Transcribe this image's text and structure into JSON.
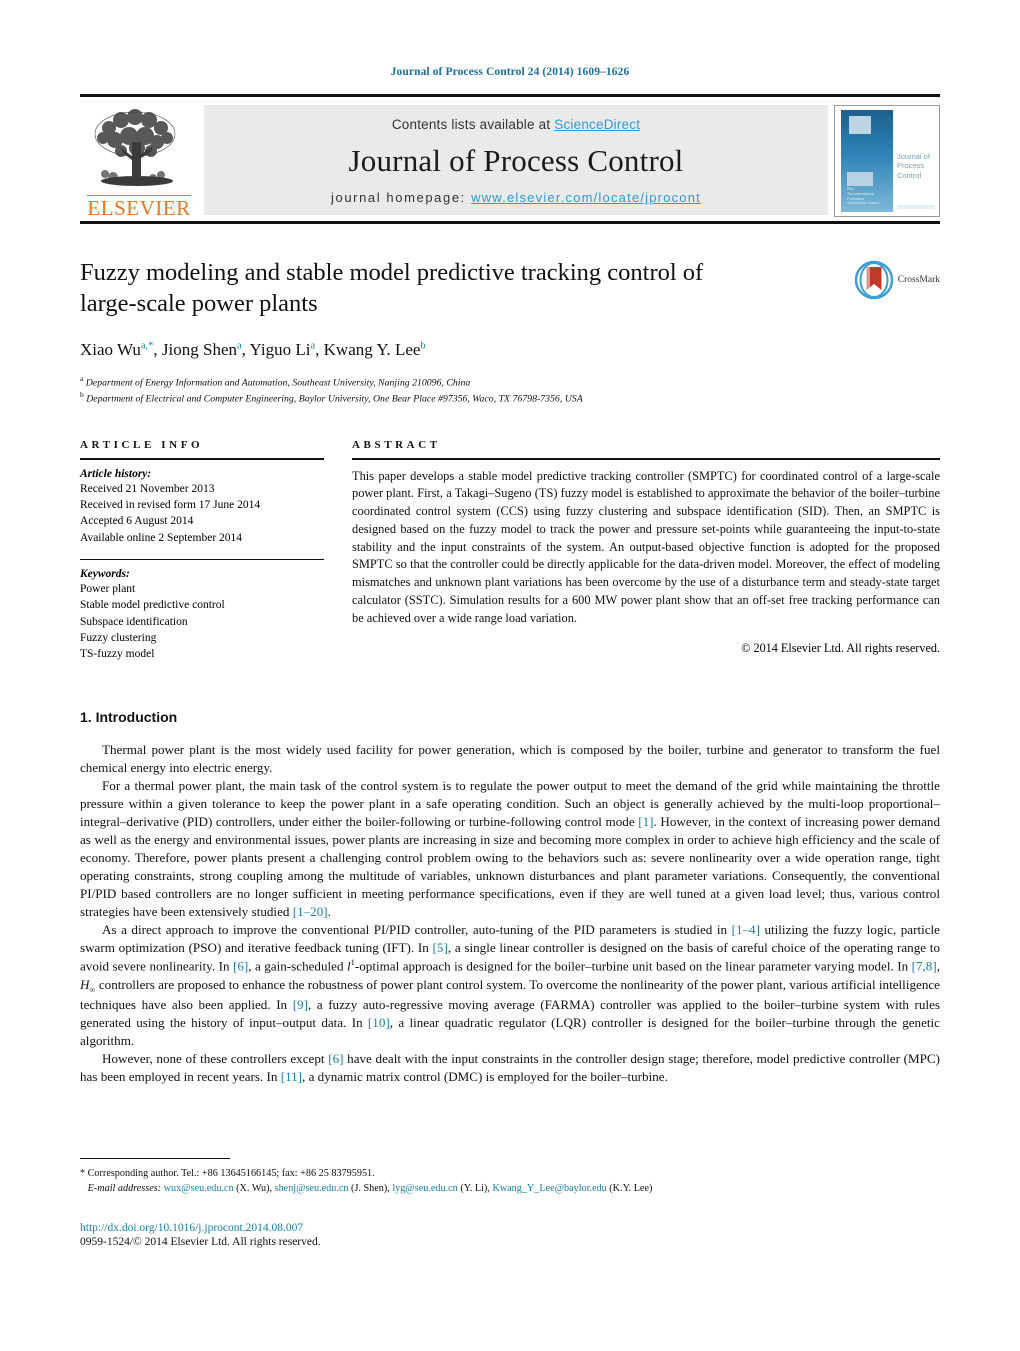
{
  "running_head": "Journal of Process Control 24 (2014) 1609–1626",
  "header": {
    "contents_prefix": "Contents lists available at ",
    "sciencedirect": "ScienceDirect",
    "journal_name": "Journal of Process Control",
    "homepage_prefix": "journal homepage: ",
    "homepage_url": "www.elsevier.com/locate/jprocont",
    "publisher_wordmark": "ELSEVIER",
    "cover_title": "Journal of\nProcess Control",
    "link_color": "#2e9bd6",
    "brand_orange": "#e87722"
  },
  "title": "Fuzzy modeling and stable model predictive tracking control of large-scale power plants",
  "authors_plain": "Xiao Wu a,*, Jiong Shen a, Yiguo Li a, Kwang Y. Lee b",
  "affiliations": [
    "Department of Energy Information and Automation, Southeast University, Nanjing 210096, China",
    "Department of Electrical and Computer Engineering, Baylor University, One Bear Place #97356, Waco, TX 76798-7356, USA"
  ],
  "crossmark_label": "CrossMark",
  "article_info": {
    "heading": "ARTICLE INFO",
    "history_label": "Article history:",
    "history": [
      "Received 21 November 2013",
      "Received in revised form 17 June 2014",
      "Accepted 6 August 2014",
      "Available online 2 September 2014"
    ],
    "keywords_label": "Keywords:",
    "keywords": [
      "Power plant",
      "Stable model predictive control",
      "Subspace identification",
      "Fuzzy clustering",
      "TS-fuzzy model"
    ]
  },
  "abstract": {
    "heading": "ABSTRACT",
    "text": "This paper develops a stable model predictive tracking controller (SMPTC) for coordinated control of a large-scale power plant. First, a Takagi–Sugeno (TS) fuzzy model is established to approximate the behavior of the boiler–turbine coordinated control system (CCS) using fuzzy clustering and subspace identification (SID). Then, an SMPTC is designed based on the fuzzy model to track the power and pressure set-points while guaranteeing the input-to-state stability and the input constraints of the system. An output-based objective function is adopted for the proposed SMPTC so that the controller could be directly applicable for the data-driven model. Moreover, the effect of modeling mismatches and unknown plant variations has been overcome by the use of a disturbance term and steady-state target calculator (SSTC). Simulation results for a 600 MW power plant show that an off-set free tracking performance can be achieved over a wide range load variation.",
    "copyright": "© 2014 Elsevier Ltd. All rights reserved."
  },
  "section": {
    "number_title": "1. Introduction",
    "paragraphs": [
      "Thermal power plant is the most widely used facility for power generation, which is composed by the boiler, turbine and generator to transform the fuel chemical energy into electric energy.",
      "For a thermal power plant, the main task of the control system is to regulate the power output to meet the demand of the grid while maintaining the throttle pressure within a given tolerance to keep the power plant in a safe operating condition. Such an object is generally achieved by the multi-loop proportional–integral–derivative (PID) controllers, under either the boiler-following or turbine-following control mode [1]. However, in the context of increasing power demand as well as the energy and environmental issues, power plants are increasing in size and becoming more complex in order to achieve high efficiency and the scale of economy. Therefore, power plants present a challenging control problem owing to the behaviors such as: severe nonlinearity over a wide operation range, tight operating constraints, strong coupling among the multitude of variables, unknown disturbances and plant parameter variations. Consequently, the conventional PI/PID based controllers are no longer sufficient in meeting performance specifications, even if they are well tuned at a given load level; thus, various control strategies have been extensively studied [1–20].",
      "As a direct approach to improve the conventional PI/PID controller, auto-tuning of the PID parameters is studied in [1–4] utilizing the fuzzy logic, particle swarm optimization (PSO) and iterative feedback tuning (IFT). In [5], a single linear controller is designed on the basis of careful choice of the operating range to avoid severe nonlinearity. In [6], a gain-scheduled l1-optimal approach is designed for the boiler–turbine unit based on the linear parameter varying model. In [7,8], H∞ controllers are proposed to enhance the robustness of power plant control system. To overcome the nonlinearity of the power plant, various artificial intelligence techniques have also been applied. In [9], a fuzzy auto-regressive moving average (FARMA) controller was applied to the boiler–turbine system with rules generated using the history of input–output data. In [10], a linear quadratic regulator (LQR) controller is designed for the boiler–turbine through the genetic algorithm.",
      "However, none of these controllers except [6] have dealt with the input constraints in the controller design stage; therefore, model predictive controller (MPC) has been employed in recent years. In [11], a dynamic matrix control (DMC) is employed for the boiler–turbine."
    ]
  },
  "footnote": {
    "corresponding": "* Corresponding author. Tel.: +86 13645166145; fax: +86 25 83795951.",
    "email_label": "E-mail addresses:",
    "emails": [
      {
        "address": "wux@seu.edu.cn",
        "name": "(X. Wu)"
      },
      {
        "address": "shenj@seu.edu.cn",
        "name": "(J. Shen)"
      },
      {
        "address": "lyg@seu.edu.cn",
        "name": "(Y. Li)"
      },
      {
        "address": "Kwang_Y_Lee@baylor.edu",
        "name": "(K.Y. Lee)"
      }
    ]
  },
  "doi": "http://dx.doi.org/10.1016/j.jprocont.2014.08.007",
  "issn_line": "0959-1524/© 2014 Elsevier Ltd. All rights reserved."
}
